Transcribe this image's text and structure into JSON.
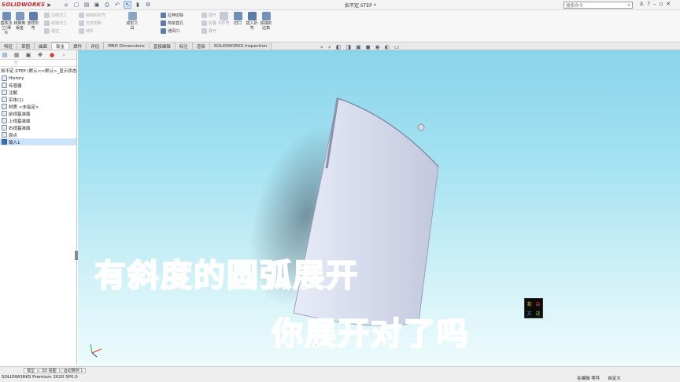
{
  "app": {
    "logo_text": "SOLIDWORKS",
    "document_title": "拟不定.STEP *",
    "search_placeholder": "搜索命令",
    "brand_color": "#c8262e",
    "accent_color": "#3c6fb0"
  },
  "quick_access": [
    "home-icon",
    "new-icon",
    "open-icon",
    "save-icon",
    "print-icon",
    "undo-icon",
    "select-icon",
    "rebuild-icon",
    "options-icon"
  ],
  "ribbon": {
    "large_buttons": [
      "基体法兰/薄片",
      "转换到钣金",
      "放样折弯"
    ],
    "small_buttons": [
      "边线法兰",
      "斜接法兰",
      "褶边",
      "绘制的折弯",
      "交叉折断",
      "转折"
    ],
    "mid_buttons": [
      "成形工具"
    ],
    "tool_list": [
      "拉伸切除",
      "简单直孔",
      "通风口"
    ],
    "right_buttons": [
      "展开",
      "折叠",
      "展开",
      "不折弯",
      "切口",
      "插入折弯",
      "焊接的边角"
    ]
  },
  "tabs": [
    "特征",
    "草图",
    "曲面",
    "钣金",
    "焊件",
    "评估",
    "MBD Dimensions",
    "直接编辑",
    "标注",
    "渲染",
    "SOLIDWORKS Inspection"
  ],
  "active_tab_index": 3,
  "feature_tree": {
    "root": "拟不定.STEP  (默认<<默认>_显示状态",
    "items": [
      "History",
      "传感器",
      "注解",
      "实体(1)",
      "材质 <未指定>",
      "前视基准面",
      "上视基准面",
      "右视基准面",
      "原点",
      "输入1"
    ],
    "selected_index": 9
  },
  "status_bar": {
    "tabs": [
      "模型",
      "3D 视图",
      "运动算例 1"
    ],
    "left_text": "SOLIDWORKS Premium 2020 SP0.0",
    "right_items": [
      "在编辑 零件",
      "自定义"
    ]
  },
  "overlay": {
    "caption_line1": "有斜度的圆弧展开",
    "caption_line2": "你展开对了吗",
    "stamp_chars": [
      "我",
      "会",
      "文",
      "道"
    ]
  }
}
